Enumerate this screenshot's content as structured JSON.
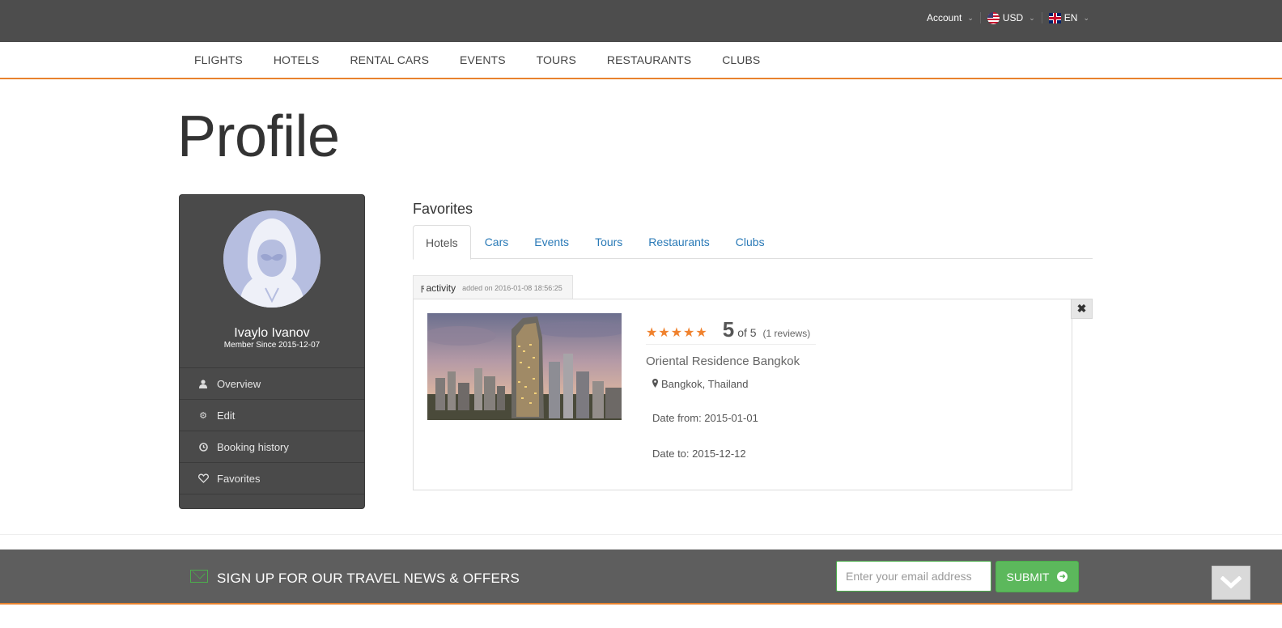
{
  "topbar": {
    "account_label": "Account",
    "currency_label": "USD",
    "language_label": "EN"
  },
  "nav": {
    "items": [
      "FLIGHTS",
      "HOTELS",
      "RENTAL CARS",
      "EVENTS",
      "TOURS",
      "RESTAURANTS",
      "CLUBS"
    ]
  },
  "page": {
    "title": "Profile"
  },
  "profile": {
    "name": "Ivaylo Ivanov",
    "member_since": "Member Since 2015-12-07",
    "menu": [
      {
        "label": "Overview",
        "icon": "user-icon"
      },
      {
        "label": "Edit",
        "icon": "gear-icon"
      },
      {
        "label": "Booking history",
        "icon": "clock-icon"
      },
      {
        "label": "Favorites",
        "icon": "heart-icon"
      }
    ]
  },
  "favorites": {
    "title": "Favorites",
    "tabs": [
      "Hotels",
      "Cars",
      "Events",
      "Tours",
      "Restaurants",
      "Clubs"
    ],
    "active_tab": "Hotels",
    "activity": {
      "label": "activity",
      "added": "added on 2016-01-08 18:56:25"
    },
    "item": {
      "rating_stars": 5,
      "rating_value": "5",
      "rating_of": "of 5",
      "reviews": "(1 reviews)",
      "name": "Oriental Residence Bangkok",
      "location": "Bangkok, Thailand",
      "date_from": "Date from: 2015-01-01",
      "date_to": "Date to: 2015-12-12",
      "close_symbol": "✖"
    }
  },
  "newsletter": {
    "text": "SIGN UP FOR OUR TRAVEL NEWS & OFFERS",
    "placeholder": "Enter your email address",
    "submit_label": "SUBMIT"
  },
  "colors": {
    "accent": "#e8822e",
    "topbar": "#4d4d4d",
    "sidebar": "#4a4a4a",
    "link": "#2a7ab7",
    "submit": "#5cb85c"
  }
}
